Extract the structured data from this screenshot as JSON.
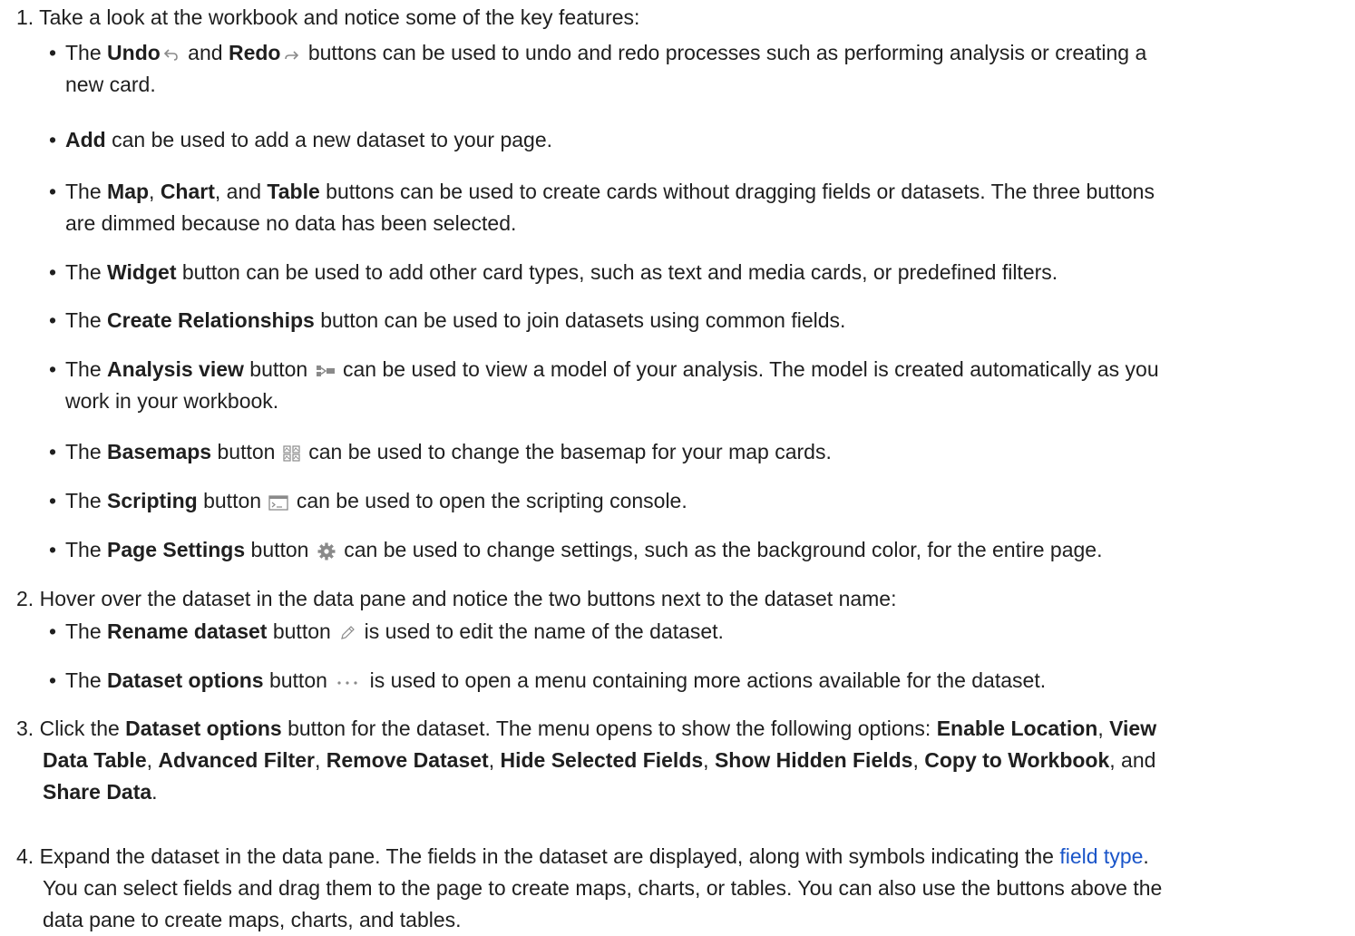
{
  "steps": [
    {
      "num": "1.",
      "text": "Take a look at the workbook and notice some of the key features:"
    },
    {
      "num": "2.",
      "text": "Hover over the dataset in the data pane and notice the two buttons next to the dataset name:"
    },
    {
      "num": "3.",
      "parts": [
        "Click the ",
        "Dataset options",
        " button for the dataset. The menu opens to show the following options: ",
        "Enable Location",
        ", ",
        "View",
        "Data Table",
        ", ",
        "Advanced Filter",
        ", ",
        "Remove Dataset",
        ", ",
        "Hide Selected Fields",
        ", ",
        "Show Hidden Fields",
        ", ",
        "Copy to Workbook",
        ", and",
        "Share Data",
        "."
      ]
    },
    {
      "num": "4.",
      "parts": [
        "Expand the dataset in the data pane. The fields in the dataset are displayed, along with symbols indicating the ",
        "field type",
        ".",
        "You can select fields and drag them to the page to create maps, charts, or tables. You can also use the buttons above the",
        "data pane to create maps, charts, and tables."
      ]
    }
  ],
  "bullets": {
    "undo_redo": {
      "p1": "The ",
      "b1": "Undo",
      "p2": " and ",
      "b2": "Redo",
      "p3": " buttons can be used to undo and redo processes such as performing analysis or creating a",
      "p4": "new card."
    },
    "add": {
      "b1": "Add",
      "p1": " can be used to add a new dataset to your page."
    },
    "map_chart_table": {
      "p1": "The ",
      "b1": "Map",
      "p2": ", ",
      "b2": "Chart",
      "p3": ", and ",
      "b3": "Table",
      "p4": " buttons can be used to create cards without dragging fields or datasets. The three buttons",
      "p5": "are dimmed because no data has been selected."
    },
    "widget": {
      "p1": "The ",
      "b1": "Widget",
      "p2": " button can be used to add other card types, such as text and media cards, or predefined filters."
    },
    "relationships": {
      "p1": "The ",
      "b1": "Create Relationships",
      "p2": " button can be used to join datasets using common fields."
    },
    "analysis": {
      "p1": "The ",
      "b1": "Analysis view",
      "p2": " button ",
      "p3": " can be used to view a model of your analysis. The model is created automatically as you",
      "p4": "work in your workbook."
    },
    "basemaps": {
      "p1": "The ",
      "b1": "Basemaps",
      "p2": " button ",
      "p3": " can be used to change the basemap for your map cards."
    },
    "scripting": {
      "p1": "The ",
      "b1": "Scripting",
      "p2": " button ",
      "p3": " can be used to open the scripting console."
    },
    "page_settings": {
      "p1": "The ",
      "b1": "Page Settings",
      "p2": " button ",
      "p3": " can be used to change settings, such as the background color, for the entire page."
    },
    "rename": {
      "p1": "The ",
      "b1": "Rename dataset",
      "p2": " button ",
      "p3": " is used to edit the name of the dataset."
    },
    "dataset_options": {
      "p1": "The ",
      "b1": "Dataset options",
      "p2": " button ",
      "p3": " is used to open a menu containing more actions available for the dataset."
    }
  },
  "bullet_char": "•",
  "icons": [
    "undo-icon",
    "redo-icon",
    "analysis-view-icon",
    "basemaps-icon",
    "scripting-icon",
    "page-settings-icon",
    "rename-icon",
    "dataset-options-icon"
  ],
  "colors": {
    "text": "#1f1f1f",
    "link": "#1a55c9",
    "icon": "#8a8a8a"
  }
}
